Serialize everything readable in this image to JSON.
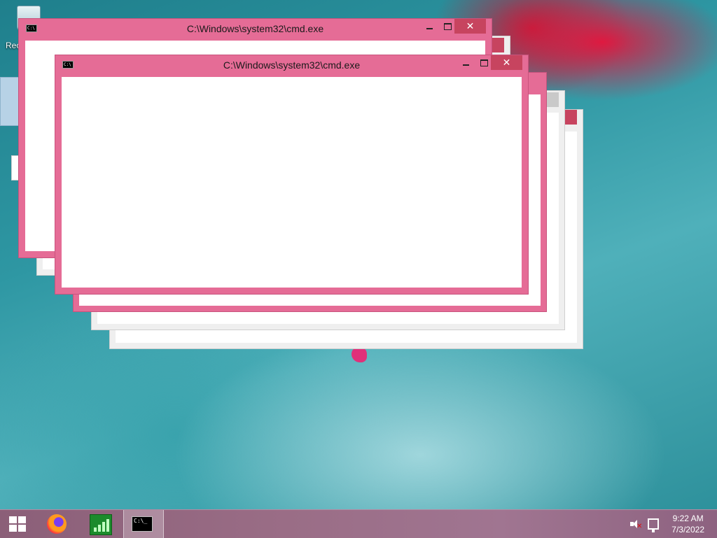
{
  "desktop": {
    "recycle_bin_label": "Rec"
  },
  "windows": [
    {
      "id": "cmd-back",
      "title": "C:\\Windows\\system32\\cmd.exe",
      "icon": "cmd-icon",
      "close": "✕"
    },
    {
      "id": "cmd-front",
      "title": "C:\\Windows\\system32\\cmd.exe",
      "icon": "cmd-icon",
      "close": "✕"
    }
  ],
  "ghost_windows": {
    "close": "✕"
  },
  "taskbar": {
    "items": [
      {
        "name": "start",
        "icon": "windows-logo-icon"
      },
      {
        "name": "firefox",
        "icon": "firefox-icon"
      },
      {
        "name": "task-manager",
        "icon": "task-manager-icon"
      },
      {
        "name": "command-prompt",
        "icon": "cmd-icon",
        "active": true,
        "icon_text": "C:\\_"
      }
    ],
    "tray": {
      "volume_icon": "speaker-muted-icon",
      "network_icon": "network-icon",
      "time": "9:22 AM",
      "date": "7/3/2022"
    }
  },
  "colors": {
    "window_frame_active": "#e56c96",
    "window_frame_inactive": "#efefef",
    "close_button": "#c7445f",
    "taskbar": "#9a6d86"
  }
}
